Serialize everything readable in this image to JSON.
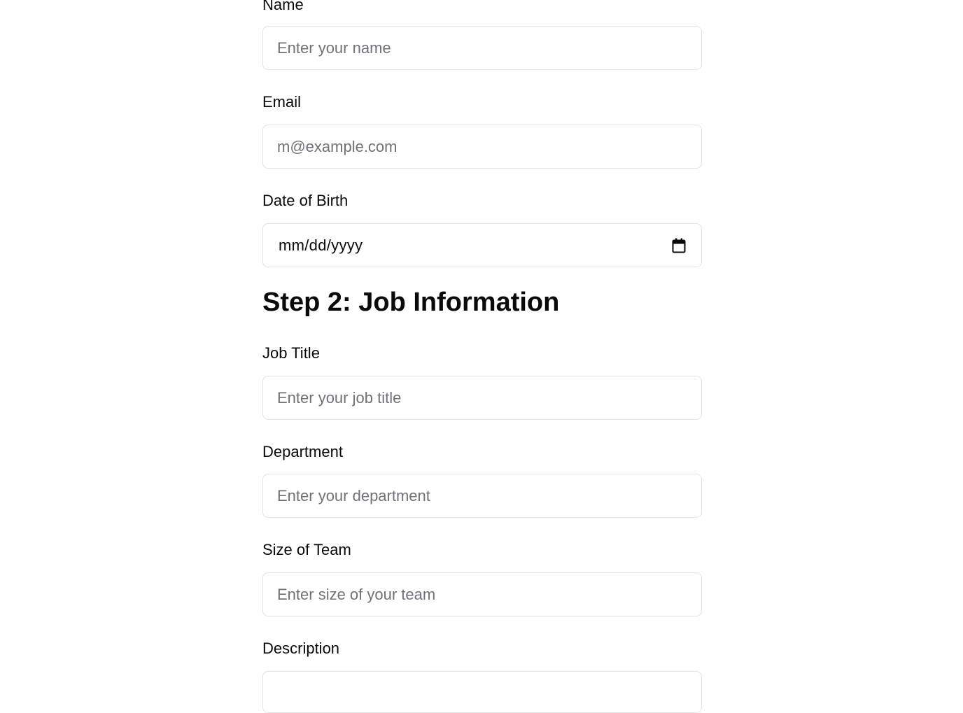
{
  "personal": {
    "name_label": "Name",
    "name_placeholder": "Enter your name",
    "email_label": "Email",
    "email_placeholder": "m@example.com",
    "dob_label": "Date of Birth",
    "dob_value": "mm/dd/yyyy",
    "dob_icon": "calendar-icon"
  },
  "job": {
    "heading": "Step 2: Job Information",
    "title_label": "Job Title",
    "title_placeholder": "Enter your job title",
    "department_label": "Department",
    "department_placeholder": "Enter your department",
    "team_size_label": "Size of Team",
    "team_size_placeholder": "Enter size of your team",
    "description_label": "Description"
  },
  "colors": {
    "border": "#e4e4e7",
    "placeholder": "#71717a",
    "text": "#0a0a0a"
  }
}
